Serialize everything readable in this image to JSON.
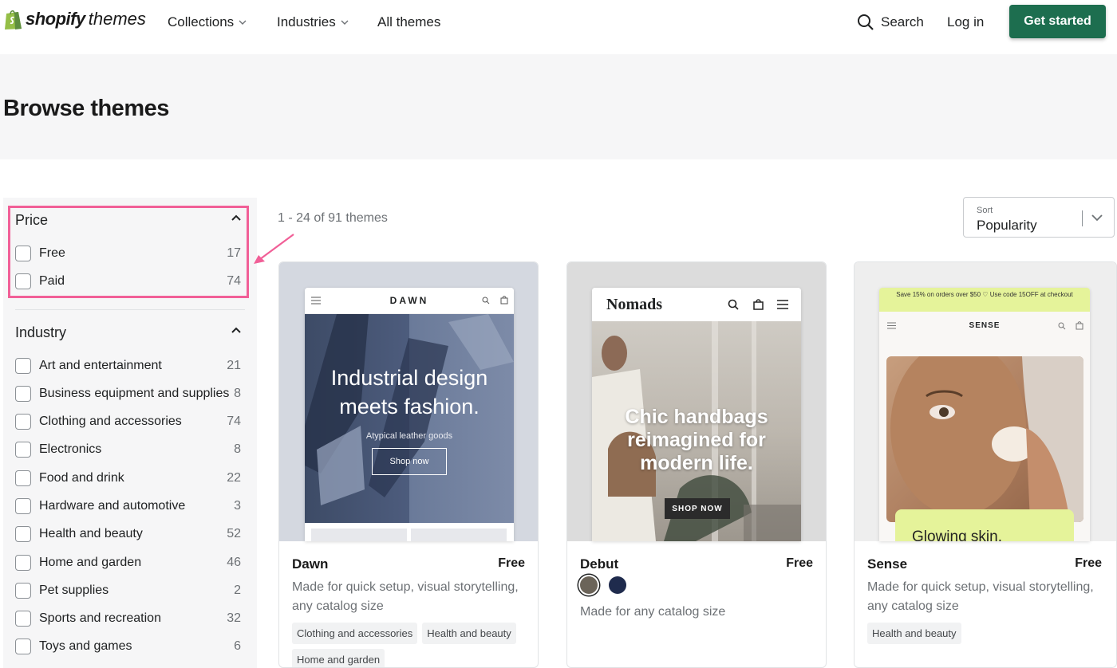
{
  "nav": {
    "brand_bold": "shopify",
    "brand_light": "themes",
    "collections": "Collections",
    "industries": "Industries",
    "all_themes": "All themes",
    "search": "Search",
    "login": "Log in",
    "get_started": "Get started"
  },
  "hero": {
    "title": "Browse themes"
  },
  "filters": {
    "price": {
      "heading": "Price",
      "items": [
        {
          "label": "Free",
          "count": "17"
        },
        {
          "label": "Paid",
          "count": "74"
        }
      ]
    },
    "industry": {
      "heading": "Industry",
      "items": [
        {
          "label": "Art and entertainment",
          "count": "21"
        },
        {
          "label": "Business equipment and supplies",
          "count": "8"
        },
        {
          "label": "Clothing and accessories",
          "count": "74"
        },
        {
          "label": "Electronics",
          "count": "8"
        },
        {
          "label": "Food and drink",
          "count": "22"
        },
        {
          "label": "Hardware and automotive",
          "count": "3"
        },
        {
          "label": "Health and beauty",
          "count": "52"
        },
        {
          "label": "Home and garden",
          "count": "46"
        },
        {
          "label": "Pet supplies",
          "count": "2"
        },
        {
          "label": "Sports and recreation",
          "count": "32"
        },
        {
          "label": "Toys and games",
          "count": "6"
        }
      ]
    }
  },
  "results": {
    "count_text": "1 - 24 of 91 themes",
    "sort_label": "Sort",
    "sort_value": "Popularity"
  },
  "themes": [
    {
      "name": "Dawn",
      "price": "Free",
      "description": "Made for quick setup, visual storytelling, any catalog size",
      "tags": [
        "Clothing and accessories",
        "Health and beauty",
        "Home and garden"
      ],
      "preview": {
        "brand": "DAWN",
        "headline_1": "Industrial design",
        "headline_2": "meets fashion.",
        "sub": "Atypical leather goods",
        "cta": "Shop now"
      }
    },
    {
      "name": "Debut",
      "price": "Free",
      "description": "Made for any catalog size",
      "swatches": [
        "#6b6459",
        "#1f2b4d"
      ],
      "preview": {
        "brand": "Nomads",
        "headline_1": "Chic handbags",
        "headline_2": "reimagined for",
        "headline_3": "modern life.",
        "cta": "SHOP NOW"
      }
    },
    {
      "name": "Sense",
      "price": "Free",
      "description": "Made for quick setup, visual storytelling, any catalog size",
      "tags": [
        "Health and beauty"
      ],
      "preview": {
        "banner": "Save 15% on orders over $50 ♡ Use code 15OFF at checkout",
        "brand": "SENSE",
        "headline": "Glowing skin."
      }
    }
  ],
  "colors": {
    "accent": "#1d6e4f",
    "highlight": "#f15f97"
  }
}
